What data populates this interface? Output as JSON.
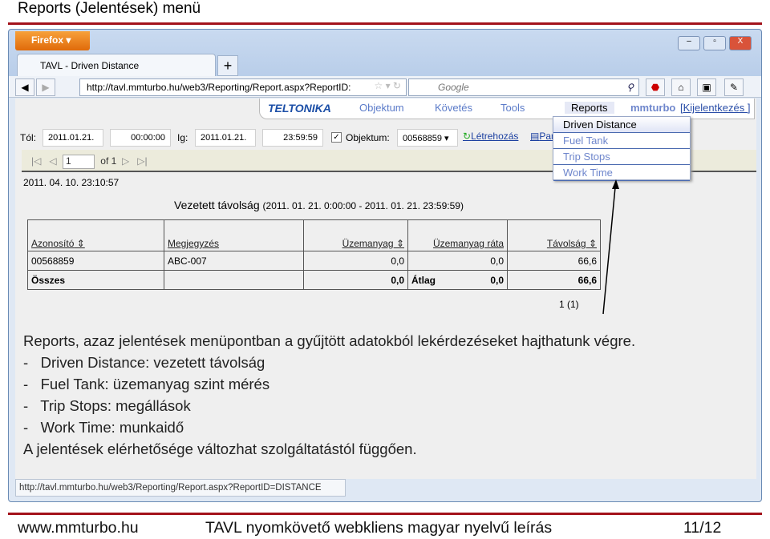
{
  "slide": {
    "title": "Reports (Jelentések) menü",
    "footer_left": "www.mmturbo.hu",
    "footer_center": "TAVL nyomkövető webkliens magyar nyelvű leírás",
    "footer_right": "11/12",
    "accent": "#a3121b"
  },
  "browser": {
    "menu_button": "Firefox ▾",
    "tab_title": "TAVL - Driven Distance",
    "new_tab": "+",
    "url": "http://tavl.mmturbo.hu/web3/Reporting/Report.aspx?ReportID:",
    "search_placeholder": "Google",
    "status_url": "http://tavl.mmturbo.hu/web3/Reporting/Report.aspx?ReportID=DISTANCE"
  },
  "app": {
    "logo": "TELTONIKA",
    "menu": [
      "Objektum",
      "Követés",
      "Tools",
      "Reports"
    ],
    "user": "mmturbo",
    "logout": "[Kijelentkezés ]",
    "dropdown": [
      "Driven Distance",
      "Fuel Tank",
      "Trip Stops",
      "Work Time"
    ],
    "form": {
      "from_label": "Tól:",
      "from_date": "2011.01.21.",
      "from_time": "00:00:00",
      "to_label": "Ig:",
      "to_date": "2011.01.21.",
      "to_time": "23:59:59",
      "object_label": "Objektum:",
      "object_value": "00568859",
      "object_checked": true,
      "create": "Létrehozás",
      "params": "Para"
    },
    "pager": {
      "page": "1",
      "of": "of 1"
    },
    "timestamp": "2011. 04. 10. 23:10:57",
    "report_title": "Vezetett távolság",
    "report_range": "(2011. 01. 21. 0:00:00 - 2011. 01. 21. 23:59:59)",
    "table": {
      "headers": [
        "Azonosító",
        "Megjegyzés",
        "Üzemanyag",
        "Üzemanyag ráta",
        "Távolság"
      ],
      "rows": [
        [
          "00568859",
          "ABC-007",
          "0,0",
          "0,0",
          "66,6"
        ]
      ],
      "total": {
        "label": "Összes",
        "fuel": "0,0",
        "avg_label": "Átlag",
        "rate": "0,0",
        "distance": "66,6"
      }
    },
    "page_count": "1 (1)"
  },
  "overlay": [
    "Reports, azaz jelentések menüpontban a gyűjtött adatokból lekérdezéseket hajthatunk végre.",
    "-   Driven Distance: vezetett távolság",
    "-   Fuel Tank: üzemanyag szint mérés",
    "-   Trip Stops: megállások",
    "-   Work Time: munkaidő",
    "A jelentések elérhetősége változhat szolgáltatástól függően."
  ]
}
